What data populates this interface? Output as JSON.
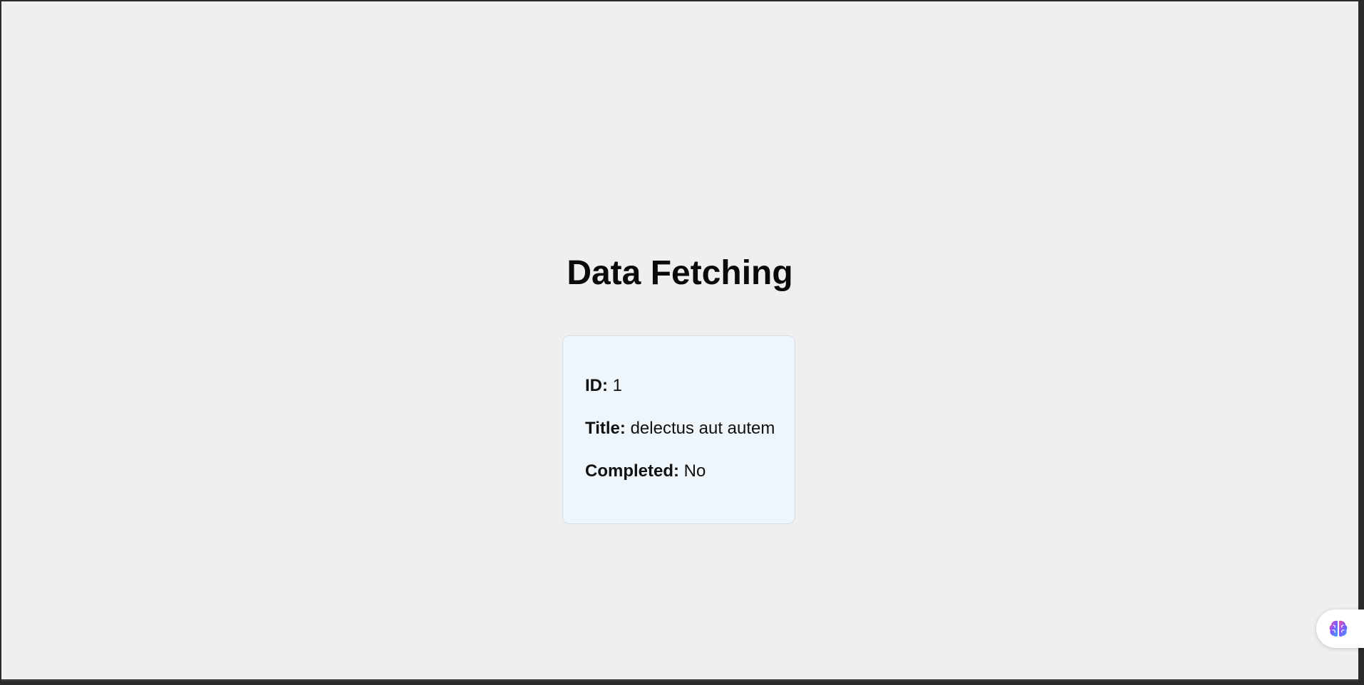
{
  "page": {
    "title": "Data Fetching"
  },
  "todo_card": {
    "id_label": "ID:",
    "id_value": "1",
    "title_label": "Title:",
    "title_value": "delectus aut autem",
    "completed_label": "Completed:",
    "completed_value": "No"
  },
  "assistant_button": {
    "icon": "brain-icon",
    "colors": [
      "#ff4fa0",
      "#7a5cff",
      "#3ba6ff"
    ]
  }
}
